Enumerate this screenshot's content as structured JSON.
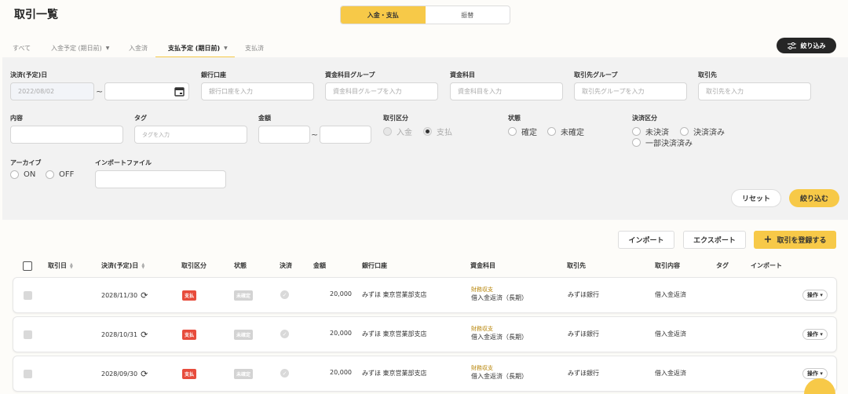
{
  "header": {
    "title": "取引一覧"
  },
  "segment": {
    "left": "入金・支払",
    "right": "振替"
  },
  "tabs": [
    {
      "label": "すべて"
    },
    {
      "label": "入金予定 (期日前)"
    },
    {
      "label": "入金済"
    },
    {
      "label": "支払予定 (期日前)"
    },
    {
      "label": "支払済"
    }
  ],
  "filter_button": "絞り込み",
  "filters": {
    "settle_date": {
      "label": "決済(予定)日",
      "from": "2022/08/02",
      "tilde": "~"
    },
    "bank": {
      "label": "銀行口座",
      "placeholder": "銀行口座を入力"
    },
    "fund_group": {
      "label": "資金科目グループ",
      "placeholder": "資金科目グループを入力"
    },
    "fund": {
      "label": "資金科目",
      "placeholder": "資金科目を入力"
    },
    "partner_group": {
      "label": "取引先グループ",
      "placeholder": "取引先グループを入力"
    },
    "partner": {
      "label": "取引先",
      "placeholder": "取引先を入力"
    },
    "content": {
      "label": "内容"
    },
    "tag": {
      "label": "タグ",
      "placeholder": "タグを入力"
    },
    "amount": {
      "label": "金額",
      "tilde": "~"
    },
    "txn_type": {
      "label": "取引区分",
      "opt1": "入金",
      "opt2": "支払"
    },
    "status": {
      "label": "状態",
      "opt1": "確定",
      "opt2": "未確定"
    },
    "settlement": {
      "label": "決済区分",
      "opt1": "未決済",
      "opt2": "決済済み",
      "opt3": "一部決済済み"
    },
    "archive": {
      "label": "アーカイブ",
      "opt1": "ON",
      "opt2": "OFF"
    },
    "import_file": {
      "label": "インポートファイル"
    },
    "reset": "リセット",
    "apply": "絞り込む"
  },
  "actions": {
    "import": "インポート",
    "export": "エクスポート",
    "add": "取引を登録する"
  },
  "table": {
    "headers": {
      "date": "取引日",
      "settle": "決済(予定)日",
      "type": "取引区分",
      "status": "状態",
      "settled": "決済",
      "amount": "金額",
      "bank": "銀行口座",
      "fund": "資金科目",
      "partner": "取引先",
      "content": "取引内容",
      "tag": "タグ",
      "import": "インポート"
    },
    "rows": [
      {
        "settle": "2028/11/30",
        "type": "支払",
        "status": "未確定",
        "amount": "20,000",
        "bank": "みずほ 東京営業部支店",
        "fund_group": "財務収支",
        "fund": "借入金返済（長期）",
        "partner": "みずほ銀行",
        "content": "借入金返済",
        "op": "操作"
      },
      {
        "settle": "2028/10/31",
        "type": "支払",
        "status": "未確定",
        "amount": "20,000",
        "bank": "みずほ 東京営業部支店",
        "fund_group": "財務収支",
        "fund": "借入金返済（長期）",
        "partner": "みずほ銀行",
        "content": "借入金返済",
        "op": "操作"
      },
      {
        "settle": "2028/09/30",
        "type": "支払",
        "status": "未確定",
        "amount": "20,000",
        "bank": "みずほ 東京営業部支店",
        "fund_group": "財務収支",
        "fund": "借入金返済（長期）",
        "partner": "みずほ銀行",
        "content": "借入金返済",
        "op": "操作"
      }
    ]
  },
  "colors": {
    "accent": "#f7c948",
    "dark": "#262626",
    "danger": "#e74c3c"
  }
}
